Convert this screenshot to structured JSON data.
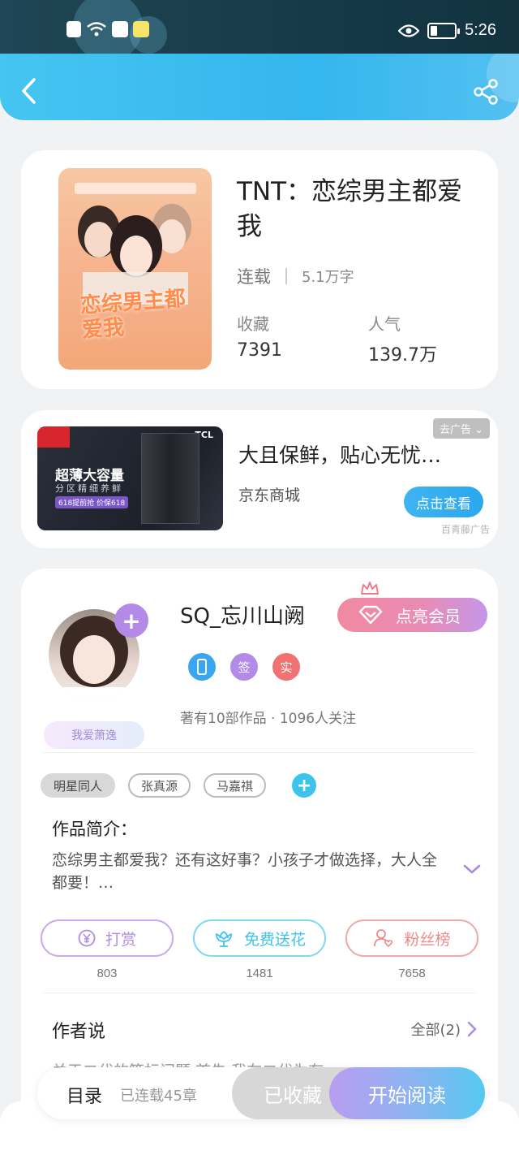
{
  "status_bar": {
    "time": "5:26"
  },
  "header": {
    "back_icon": "chevron-left-icon",
    "share_icon": "share-icon"
  },
  "book": {
    "title": "TNT：恋综男主都爱我",
    "status": "连载",
    "words": "5.1万字",
    "collect_label": "收藏",
    "collect_value": "7391",
    "popularity_label": "人气",
    "popularity_value": "139.7万",
    "cover_text": "恋综男主都爱我"
  },
  "ad": {
    "title": "大且保鲜，贴心无忧…",
    "brand": "京东商城",
    "close_label": "去广告",
    "cta": "点击查看",
    "source": "百青藤广告",
    "image_headline": "超薄大容量",
    "image_sub": "分区精细养鲜",
    "image_promo": "618提前抢 价保618",
    "image_brand": "TCL"
  },
  "author": {
    "name": "SQ_忘川山阙",
    "vip_label": "点亮会员",
    "fan_badge": "我爱萧逸",
    "badges": [
      {
        "label": "",
        "color": "#3aa6f2"
      },
      {
        "label": "签",
        "color": "#b38ae8"
      },
      {
        "label": "实",
        "color": "#f07272"
      }
    ],
    "works_info": "著有10部作品 · 1096人关注"
  },
  "tags": [
    "明星同人",
    "张真源",
    "马嘉祺"
  ],
  "intro": {
    "label": "作品简介：",
    "text": "恋综男主都爱我？还有这好事？小孩子才做选择，大人全都要！…"
  },
  "actions": [
    {
      "label": "打赏",
      "count": "803",
      "color": "#b38ae8"
    },
    {
      "label": "免费送花",
      "count": "1481",
      "color": "#3cc4ec"
    },
    {
      "label": "粉丝榜",
      "count": "7658",
      "color": "#ef8a8a"
    }
  ],
  "author_says": {
    "title": "作者说",
    "all_label": "全部(2)",
    "preview": "关于二代的等标问题 首先 我在二代为有"
  },
  "bottom_bar": {
    "toc_label": "目录",
    "toc_count": "已连载45章",
    "collected_label": "已收藏",
    "read_label": "开始阅读"
  }
}
